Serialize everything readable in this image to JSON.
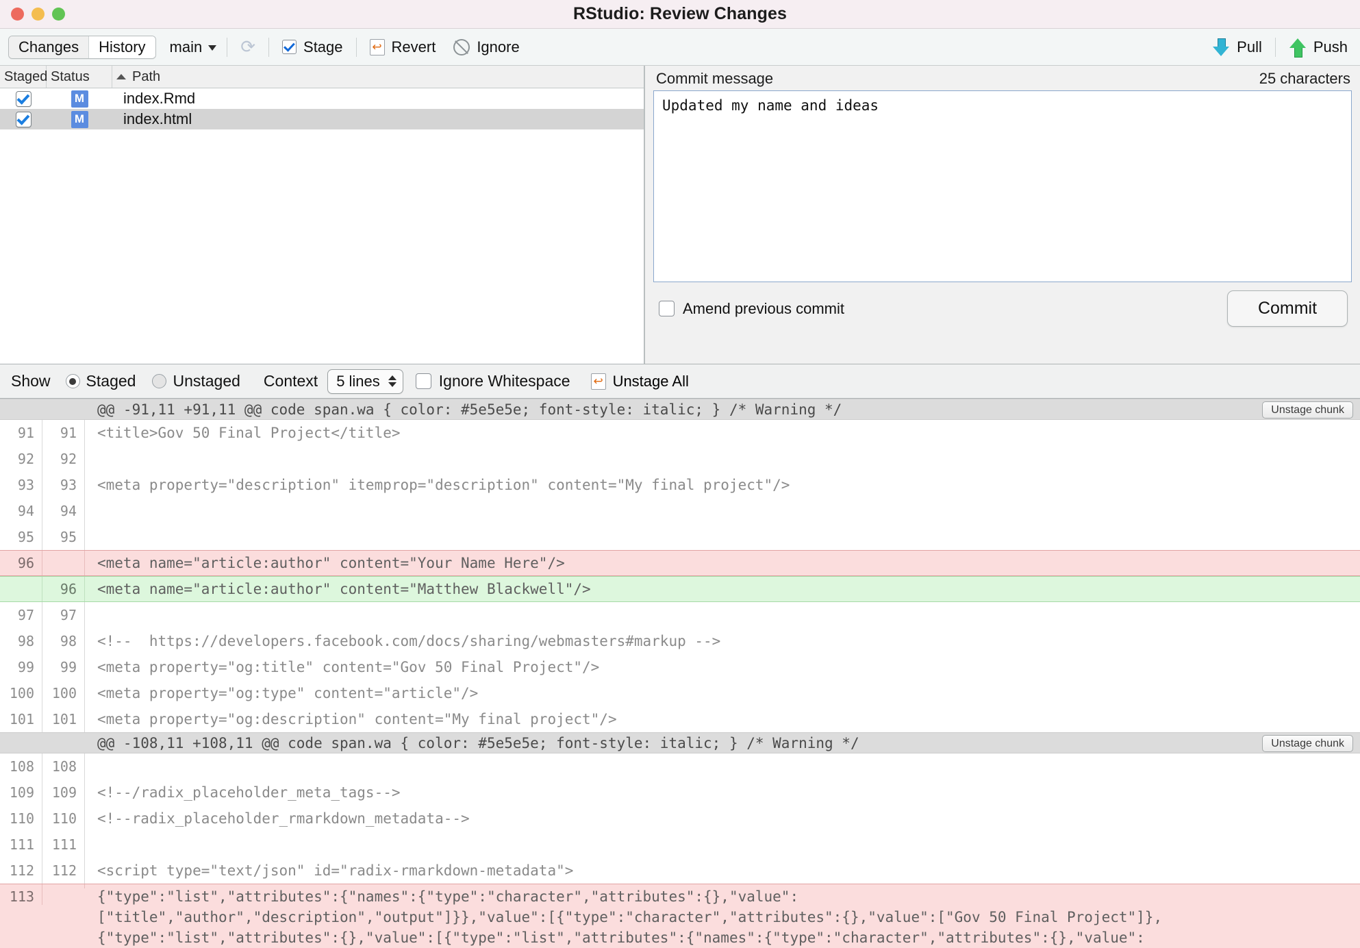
{
  "window": {
    "title": "RStudio: Review Changes",
    "traffic_lights": [
      "close",
      "minimize",
      "zoom"
    ]
  },
  "toolbar": {
    "tabs": [
      {
        "label": "Changes",
        "active": false
      },
      {
        "label": "History",
        "active": true
      }
    ],
    "branch": "main",
    "refresh_icon": "refresh-icon",
    "stage_label": "Stage",
    "revert_label": "Revert",
    "ignore_label": "Ignore",
    "pull_label": "Pull",
    "push_label": "Push"
  },
  "files": {
    "columns": [
      "Staged",
      "Status",
      "Path"
    ],
    "sort": "Path ascending",
    "rows": [
      {
        "staged": true,
        "status": "M",
        "path": "index.Rmd",
        "selected": false
      },
      {
        "staged": true,
        "status": "M",
        "path": "index.html",
        "selected": true
      }
    ]
  },
  "commit": {
    "heading": "Commit message",
    "char_count": "25 characters",
    "message": "Updated my name and ideas",
    "amend_label": "Amend previous commit",
    "amend_checked": false,
    "commit_button": "Commit"
  },
  "diff_options": {
    "show_label": "Show",
    "staged_label": "Staged",
    "unstaged_label": "Unstaged",
    "selected": "Staged",
    "context_label": "Context",
    "context_value": "5 lines",
    "ignore_whitespace_label": "Ignore Whitespace",
    "ignore_whitespace_checked": false,
    "unstage_all_label": "Unstage All"
  },
  "diff": {
    "chunk_button_label": "Unstage chunk",
    "hunks": [
      {
        "header": "@@ -91,11 +91,11 @@ code span.wa { color: #5e5e5e; font-style: italic; } /* Warning */",
        "lines": [
          {
            "type": "ctx",
            "old": "91",
            "new": "91",
            "text": "<title>Gov 50 Final Project</title>"
          },
          {
            "type": "ctx",
            "old": "92",
            "new": "92",
            "text": ""
          },
          {
            "type": "ctx",
            "old": "93",
            "new": "93",
            "text": "<meta property=\"description\" itemprop=\"description\" content=\"My final project\"/>"
          },
          {
            "type": "ctx",
            "old": "94",
            "new": "94",
            "text": ""
          },
          {
            "type": "ctx",
            "old": "95",
            "new": "95",
            "text": ""
          },
          {
            "type": "del",
            "old": "96",
            "new": "",
            "text": "<meta name=\"article:author\" content=\"Your Name Here\"/>"
          },
          {
            "type": "ins",
            "old": "",
            "new": "96",
            "text": "<meta name=\"article:author\" content=\"Matthew Blackwell\"/>"
          },
          {
            "type": "ctx",
            "old": "97",
            "new": "97",
            "text": ""
          },
          {
            "type": "ctx",
            "old": "98",
            "new": "98",
            "text": "<!--  https://developers.facebook.com/docs/sharing/webmasters#markup -->"
          },
          {
            "type": "ctx",
            "old": "99",
            "new": "99",
            "text": "<meta property=\"og:title\" content=\"Gov 50 Final Project\"/>"
          },
          {
            "type": "ctx",
            "old": "100",
            "new": "100",
            "text": "<meta property=\"og:type\" content=\"article\"/>"
          },
          {
            "type": "ctx",
            "old": "101",
            "new": "101",
            "text": "<meta property=\"og:description\" content=\"My final project\"/>"
          }
        ]
      },
      {
        "header": "@@ -108,11 +108,11 @@ code span.wa { color: #5e5e5e; font-style: italic; } /* Warning */",
        "lines": [
          {
            "type": "ctx",
            "old": "108",
            "new": "108",
            "text": ""
          },
          {
            "type": "ctx",
            "old": "109",
            "new": "109",
            "text": "<!--/radix_placeholder_meta_tags-->"
          },
          {
            "type": "ctx",
            "old": "110",
            "new": "110",
            "text": "<!--radix_placeholder_rmarkdown_metadata-->"
          },
          {
            "type": "ctx",
            "old": "111",
            "new": "111",
            "text": ""
          },
          {
            "type": "ctx",
            "old": "112",
            "new": "112",
            "text": "<script type=\"text/json\" id=\"radix-rmarkdown-metadata\">"
          },
          {
            "type": "del",
            "old": "113",
            "new": "",
            "wrap": true,
            "text": "{\"type\":\"list\",\"attributes\":{\"names\":{\"type\":\"character\",\"attributes\":{},\"value\":\n[\"title\",\"author\",\"description\",\"output\"]}},\"value\":[{\"type\":\"character\",\"attributes\":{},\"value\":[\"Gov 50 Final Project\"]},\n{\"type\":\"list\",\"attributes\":{},\"value\":[{\"type\":\"list\",\"attributes\":{\"names\":{\"type\":\"character\",\"attributes\":{},\"value\":"
          }
        ]
      }
    ]
  }
}
